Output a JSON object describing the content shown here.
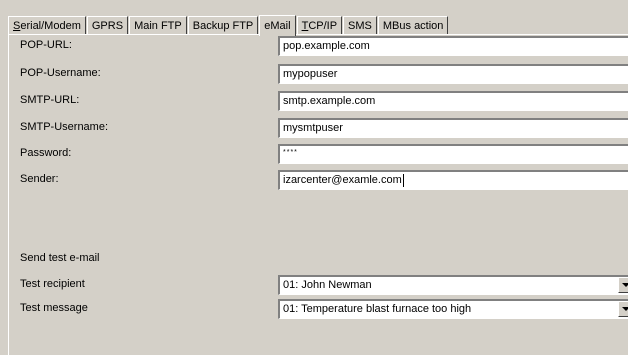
{
  "tabs": [
    {
      "label_u": "S",
      "label_rest": "erial/Modem",
      "active": false
    },
    {
      "label_u": "",
      "label_rest": "GPRS",
      "active": false
    },
    {
      "label_u": "",
      "label_rest": "Main FTP",
      "active": false
    },
    {
      "label_u": "",
      "label_rest": "Backup FTP",
      "active": false
    },
    {
      "label_u": "",
      "label_rest": "eMail",
      "active": true
    },
    {
      "label_u": "T",
      "label_rest": "CP/IP",
      "active": false
    },
    {
      "label_u": "",
      "label_rest": "SMS",
      "active": false
    },
    {
      "label_u": "",
      "label_rest": "MBus action",
      "active": false
    }
  ],
  "form": {
    "pop_url": {
      "label": "POP-URL:",
      "value": "pop.example.com"
    },
    "pop_username": {
      "label": "POP-Username:",
      "value": "mypopuser"
    },
    "smtp_url": {
      "label": "SMTP-URL:",
      "value": "smtp.example.com"
    },
    "smtp_username": {
      "label": "SMTP-Username:",
      "value": "mysmtpuser"
    },
    "password": {
      "label": "Password:",
      "value": "****"
    },
    "sender": {
      "label": "Sender:",
      "value": "izarcenter@examle.com"
    }
  },
  "test": {
    "section_label": "Send test e-mail",
    "recipient": {
      "label": "Test recipient",
      "value": "01: John Newman"
    },
    "message": {
      "label": "Test message",
      "value": "01: Temperature blast furnace too high"
    }
  }
}
